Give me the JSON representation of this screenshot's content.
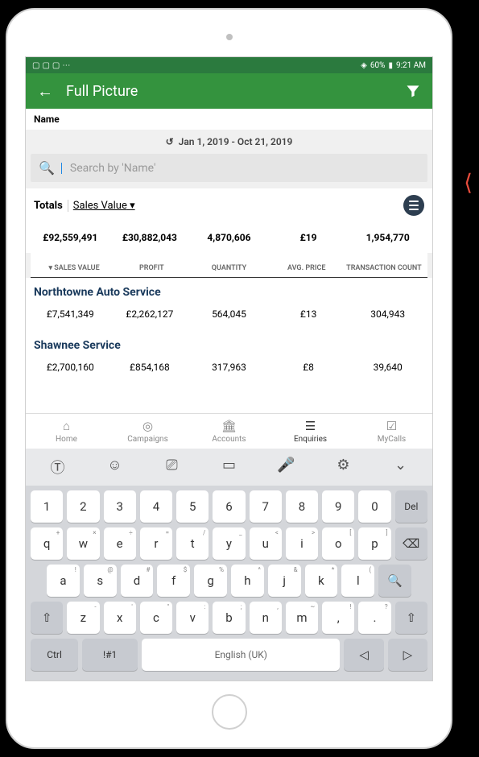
{
  "status": {
    "battery": "60%",
    "time": "9:21 AM"
  },
  "appbar": {
    "title": "Full Picture"
  },
  "name_bar": {
    "label": "Name"
  },
  "date": {
    "range": "Jan 1, 2019 - Oct 21, 2019"
  },
  "search": {
    "placeholder": "Search by 'Name'"
  },
  "totals": {
    "label": "Totals",
    "metric": "Sales Value",
    "values": [
      "£92,559,491",
      "£30,882,043",
      "4,870,606",
      "£19",
      "1,954,770"
    ]
  },
  "columns": [
    "SALES VALUE",
    "PROFIT",
    "QUANTITY",
    "AVG. PRICE",
    "TRANSACTION COUNT"
  ],
  "rows": [
    {
      "name": "Northtowne Auto Service",
      "values": [
        "£7,541,349",
        "£2,262,127",
        "564,045",
        "£13",
        "304,943"
      ]
    },
    {
      "name": "Shawnee Service",
      "values": [
        "£2,700,160",
        "£854,168",
        "317,963",
        "£8",
        "39,640"
      ]
    }
  ],
  "tabs": [
    {
      "label": "Home"
    },
    {
      "label": "Campaigns"
    },
    {
      "label": "Accounts"
    },
    {
      "label": "Enquiries"
    },
    {
      "label": "MyCalls"
    }
  ],
  "keyboard": {
    "space_label": "English (UK)",
    "row1": [
      "1",
      "2",
      "3",
      "4",
      "5",
      "6",
      "7",
      "8",
      "9",
      "0",
      "Del"
    ],
    "row2": [
      {
        "k": "q",
        "s": "+"
      },
      {
        "k": "w",
        "s": "×"
      },
      {
        "k": "e",
        "s": "÷"
      },
      {
        "k": "r",
        "s": "="
      },
      {
        "k": "t",
        "s": "/"
      },
      {
        "k": "y",
        "s": "_"
      },
      {
        "k": "u",
        "s": "<"
      },
      {
        "k": "i",
        "s": ">"
      },
      {
        "k": "o",
        "s": "["
      },
      {
        "k": "p",
        "s": "]"
      }
    ],
    "row3": [
      {
        "k": "a",
        "s": "!"
      },
      {
        "k": "s",
        "s": "@"
      },
      {
        "k": "d",
        "s": "#"
      },
      {
        "k": "f",
        "s": "$"
      },
      {
        "k": "g",
        "s": "%"
      },
      {
        "k": "h",
        "s": "^"
      },
      {
        "k": "j",
        "s": "&"
      },
      {
        "k": "k",
        "s": "*"
      },
      {
        "k": "l",
        "s": "("
      }
    ],
    "row4": [
      {
        "k": "z",
        "s": "-"
      },
      {
        "k": "x",
        "s": "'"
      },
      {
        "k": "c",
        "s": "\""
      },
      {
        "k": "v",
        "s": ":"
      },
      {
        "k": "b",
        "s": ";"
      },
      {
        "k": "n",
        "s": ","
      },
      {
        "k": "m",
        "s": "~"
      }
    ],
    "ctrl": "Ctrl",
    "sym": "!#1",
    "comma": ",",
    "period": "."
  }
}
